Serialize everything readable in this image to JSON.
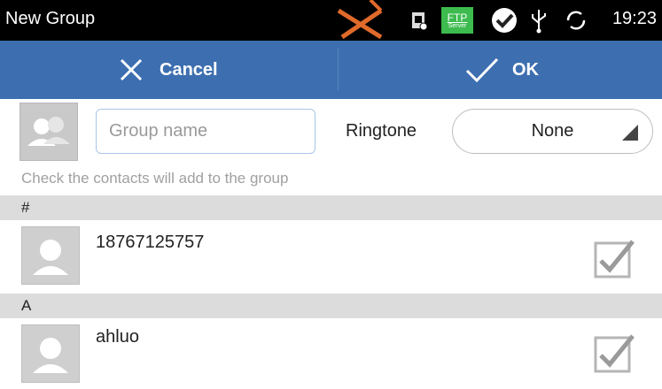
{
  "status_bar": {
    "title": "New Group",
    "time": "19:23",
    "ftp_badge": "FTP",
    "ftp_sub": "Server",
    "icons": [
      "no-sim-icon",
      "sim-card-icon",
      "ftp-server-icon",
      "check-notification-icon",
      "usb-icon",
      "sync-icon"
    ]
  },
  "action_bar": {
    "cancel_label": "Cancel",
    "ok_label": "OK"
  },
  "form": {
    "group_name_placeholder": "Group name",
    "ringtone_label": "Ringtone",
    "ringtone_value": "None",
    "hint": "Check the contacts will add to the group"
  },
  "contacts": [
    {
      "section": "#",
      "name": "18767125757",
      "checked": true
    },
    {
      "section": "A",
      "name": "ahluo",
      "checked": true
    }
  ],
  "colors": {
    "action_bar": "#3d6fb0",
    "status_bar": "#000000",
    "section_header": "#dcdcdc"
  }
}
